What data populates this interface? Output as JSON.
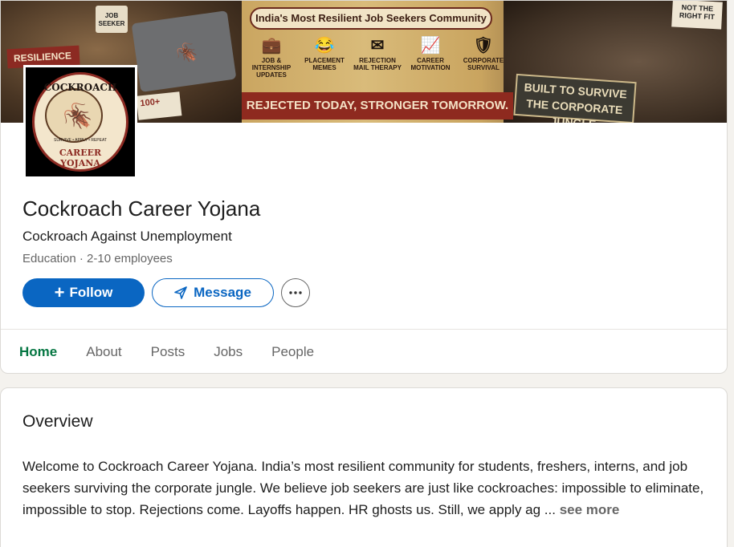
{
  "banner": {
    "ribbon": "India's Most Resilient Job Seekers Community",
    "icons": [
      {
        "glyph": "💼",
        "label": "JOB & INTERNSHIP UPDATES"
      },
      {
        "glyph": "😂",
        "label": "PLACEMENT MEMES"
      },
      {
        "glyph": "✉",
        "label": "REJECTION MAIL THERAPY"
      },
      {
        "glyph": "📈",
        "label": "CAREER MOTIVATION"
      },
      {
        "glyph": "🛡",
        "label": "CORPORATE SURVIVAL"
      }
    ],
    "slogan": "REJECTED TODAY, STRONGER TOMORROW.",
    "built": "BUILT TO SURVIVE THE CORPORATE JUNGLE",
    "resilience": "RESILIENCE",
    "jobseeker": "JOB SEEKER",
    "rightfit": "NOT THE RIGHT FIT",
    "count": "100+"
  },
  "logo": {
    "top": "COCKROACH",
    "bottom": "CAREER YOJANA",
    "small": "SURVIVE • APPLY • REPEAT"
  },
  "company": {
    "name": "Cockroach Career Yojana",
    "tagline": "Cockroach Against Unemployment",
    "meta": "Education · 2-10 employees"
  },
  "actions": {
    "follow": "Follow",
    "message": "Message"
  },
  "tabs": [
    {
      "label": "Home"
    },
    {
      "label": "About"
    },
    {
      "label": "Posts"
    },
    {
      "label": "Jobs"
    },
    {
      "label": "People"
    }
  ],
  "overview": {
    "title": "Overview",
    "text": "Welcome to Cockroach Career Yojana. India’s most resilient community for students, freshers, interns, and job seekers surviving the corporate jungle. We believe job seekers are just like cockroaches: impossible to eliminate, impossible to stop. Rejections come. Layoffs happen. HR ghosts us. Still, we apply ag ... ",
    "see_more": "see more"
  },
  "colors": {
    "primary": "#0a66c2",
    "active_tab": "#057642"
  }
}
